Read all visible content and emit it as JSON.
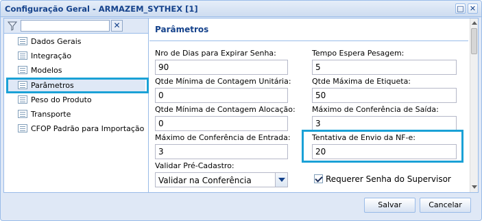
{
  "window": {
    "title": "Configuração Geral - ARMAZEM_SYTHEX [1]",
    "maximize_icon": "□",
    "close_icon": "✕"
  },
  "tree": {
    "filter_placeholder": "",
    "clear_icon": "✕",
    "items": [
      {
        "label": "Dados Gerais"
      },
      {
        "label": "Integração"
      },
      {
        "label": "Modelos"
      },
      {
        "label": "Parâmetros"
      },
      {
        "label": "Peso do Produto"
      },
      {
        "label": "Transporte"
      },
      {
        "label": "CFOP Padrão para Importação"
      }
    ],
    "selected_index": 3
  },
  "form": {
    "title": "Parâmetros",
    "fields": {
      "dias_expirar_senha": {
        "label": "Nro de Dias para Expirar Senha:",
        "value": "90"
      },
      "tempo_espera_pesagem": {
        "label": "Tempo Espera Pesagem:",
        "value": "5"
      },
      "qtde_min_contagem_unitaria": {
        "label": "Qtde Mínima de Contagem Unitária:",
        "value": "0"
      },
      "qtde_max_etiqueta": {
        "label": "Qtde Máxima de Etiqueta:",
        "value": "50"
      },
      "qtde_min_contagem_alocacao": {
        "label": "Qtde Mínima de Contagem Alocação:",
        "value": "0"
      },
      "max_conferencia_saida": {
        "label": "Máximo de Conferência de Saída:",
        "value": "3"
      },
      "max_conferencia_entrada": {
        "label": "Máximo de Conferência de Entrada:",
        "value": "3"
      },
      "tentativa_envio_nfe": {
        "label": "Tentativa de Envio da NF-e:",
        "value": "20"
      },
      "validar_pre_cadastro": {
        "label": "Validar Pré-Cadastro:",
        "value": "Validar na Conferência"
      },
      "requerer_senha_supervisor": {
        "label": "Requerer Senha do Supervisor",
        "checked": true
      }
    }
  },
  "footer": {
    "save_label": "Salvar",
    "cancel_label": "Cancelar"
  },
  "colors": {
    "accent_highlight": "#1aa1d6",
    "title_text": "#15428b",
    "frame_border": "#99bbe8"
  }
}
